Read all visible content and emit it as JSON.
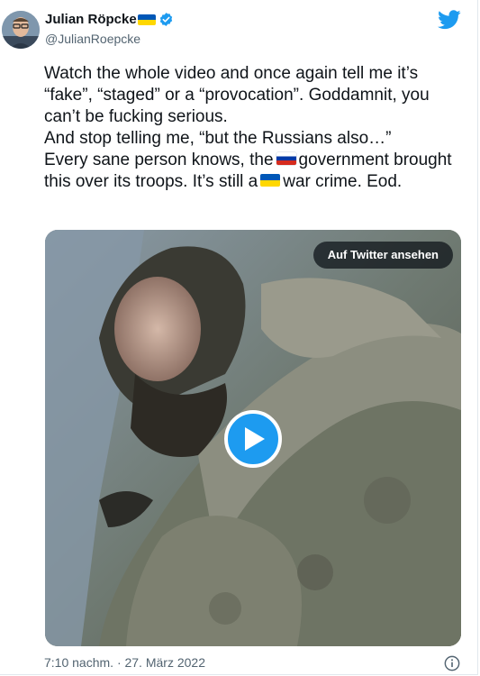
{
  "author": {
    "name": "Julian Röpcke",
    "handle": "@JulianRoepcke"
  },
  "icons": {
    "verified": "verified-badge-icon",
    "twitter": "twitter-bird-icon",
    "play": "play-icon",
    "info": "info-icon"
  },
  "colors": {
    "accent": "#1d9bf0",
    "text": "#0f1419",
    "muted": "#536471"
  },
  "tweet": {
    "line1": "Watch the whole video and once again tell me it’s “fake”, “staged” or a “provocation”. Goddamnit, you can’t be fucking serious.",
    "line2": "And stop telling me, “but the Russians also…”",
    "line3_a": "Every sane person knows, the",
    "line3_b": "government brought this over its troops. It’s still a",
    "line3_c": "war crime. Eod."
  },
  "media": {
    "view_button": "Auf Twitter ansehen"
  },
  "timestamp": "7:10 nachm. · 27. März 2022"
}
